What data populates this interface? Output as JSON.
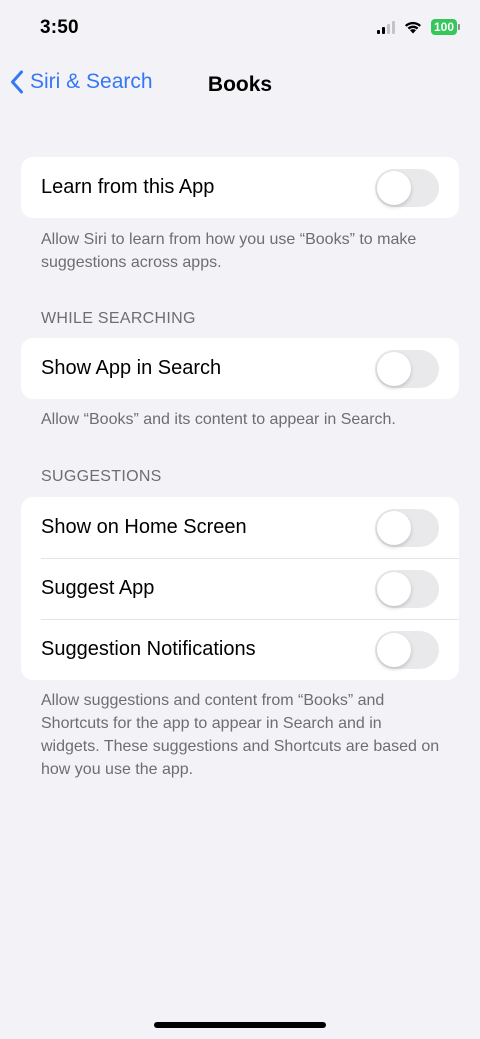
{
  "status_bar": {
    "time": "3:50",
    "battery": "100"
  },
  "nav": {
    "back_label": "Siri & Search",
    "title": "Books"
  },
  "groups": {
    "learn": {
      "label": "Learn from this App",
      "footer": "Allow Siri to learn from how you use “Books” to make suggestions across apps."
    },
    "searching": {
      "header": "WHILE SEARCHING",
      "label": "Show App in Search",
      "footer": "Allow “Books” and its content to appear in Search."
    },
    "suggestions": {
      "header": "SUGGESTIONS",
      "items": [
        {
          "label": "Show on Home Screen"
        },
        {
          "label": "Suggest App"
        },
        {
          "label": "Suggestion Notifications"
        }
      ],
      "footer": "Allow suggestions and content from “Books” and Shortcuts for the app to appear in Search and in widgets. These suggestions and Shortcuts are based on how you use the app."
    }
  },
  "colors": {
    "accent": "#3478f6",
    "battery": "#34c759",
    "toggle_off": "#e9e9eb"
  }
}
